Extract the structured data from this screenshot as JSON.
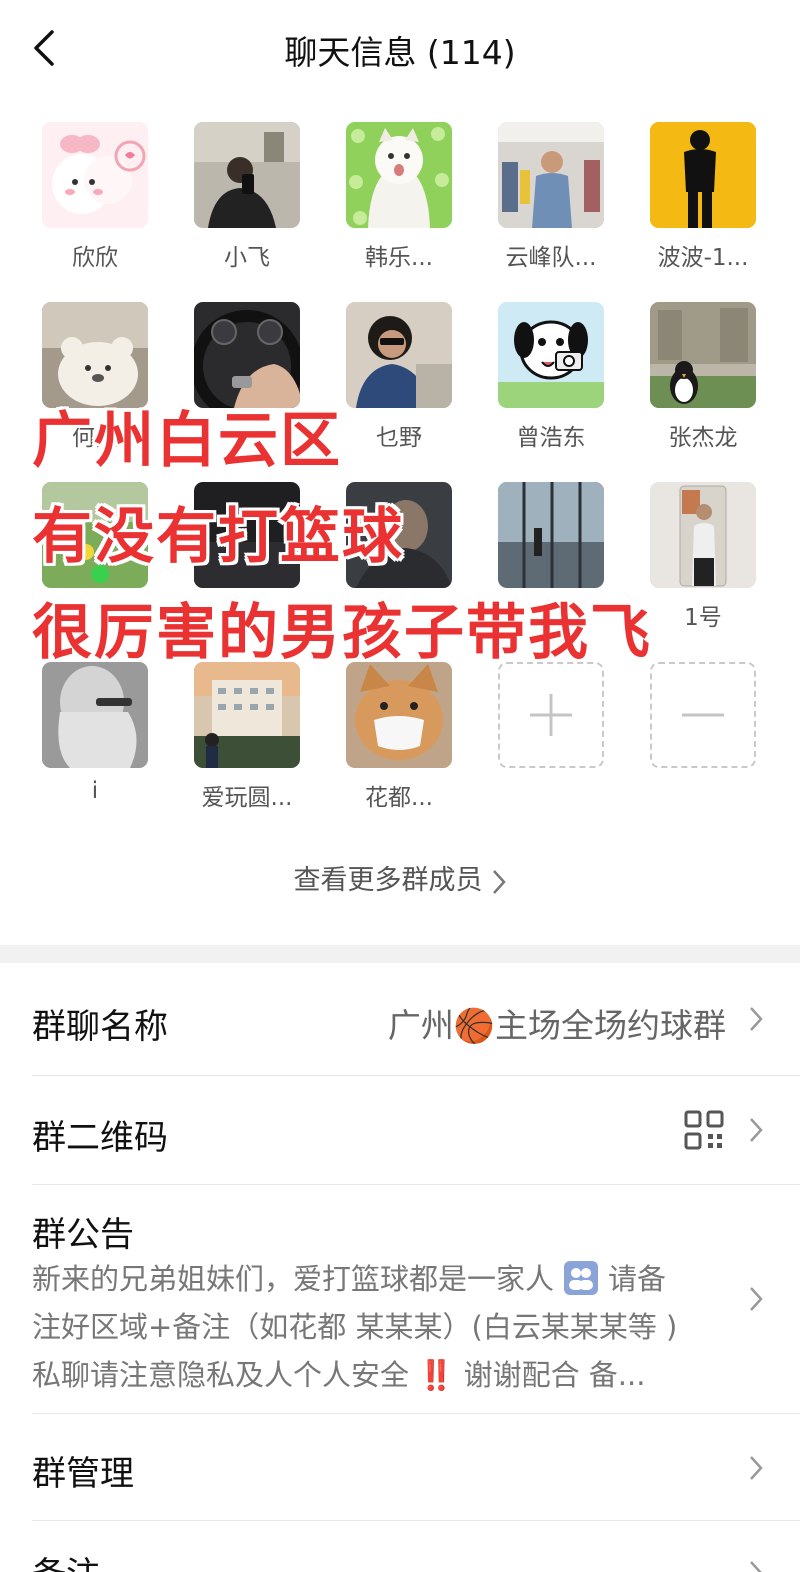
{
  "header": {
    "title": "聊天信息 (114)"
  },
  "members": [
    {
      "name": "欣欣",
      "avatar": "pink-bunny-avatar"
    },
    {
      "name": "小飞",
      "avatar": "mirror-selfie-avatar"
    },
    {
      "name": "韩乐...",
      "avatar": "white-cat-avatar"
    },
    {
      "name": "云峰队...",
      "avatar": "store-selfie-avatar"
    },
    {
      "name": "波波-1...",
      "avatar": "silhouette-avatar"
    },
    {
      "name": "何杰",
      "avatar": "teddy-bear-avatar"
    },
    {
      "name": "",
      "avatar": "steering-wheel-avatar"
    },
    {
      "name": "乜野",
      "avatar": "sunglasses-avatar"
    },
    {
      "name": "曾浩东",
      "avatar": "cartoon-dog-avatar"
    },
    {
      "name": "张杰龙",
      "avatar": "penguin-avatar"
    },
    {
      "name": "",
      "avatar": "lawn-toy-avatar"
    },
    {
      "name": "",
      "avatar": "dark-avatar"
    },
    {
      "name": "",
      "avatar": "portrait-avatar"
    },
    {
      "name": "",
      "avatar": "window-avatar"
    },
    {
      "name": "1号",
      "avatar": "mirror-avatar"
    },
    {
      "name": "i",
      "avatar": "grey-girl-avatar"
    },
    {
      "name": "爱玩圆...",
      "avatar": "building-avatar"
    },
    {
      "name": "花都...",
      "avatar": "shiba-mask-avatar"
    }
  ],
  "overlay": {
    "line1": "广州白云区",
    "line2": "有没有打篮球",
    "line3": "很厉害的男孩子带我飞"
  },
  "view_more": "查看更多群成员",
  "settings": {
    "group_name_label": "群聊名称",
    "group_name_prefix": "广州",
    "group_name_emoji": "🏀",
    "group_name_suffix": "主场全场约球群",
    "qr_label": "群二维码",
    "notice_label": "群公告",
    "notice_line1": "新来的兄弟姐妹们，爱打篮球都是一家人",
    "notice_line1_tail": "请备",
    "notice_line2": "注好区域+备注（如花都 某某某）(白云某某某等 )",
    "notice_line3a": "私聊请注意隐私及人个人安全",
    "notice_line3b": "‼️",
    "notice_line3c": "谢谢配合  备...",
    "manage_label": "群管理",
    "remark_label": "备注"
  },
  "colors": {
    "overlay_red": "#ea3232",
    "divider": "#e8e8e8",
    "section_gap": "#f1f1f1"
  }
}
